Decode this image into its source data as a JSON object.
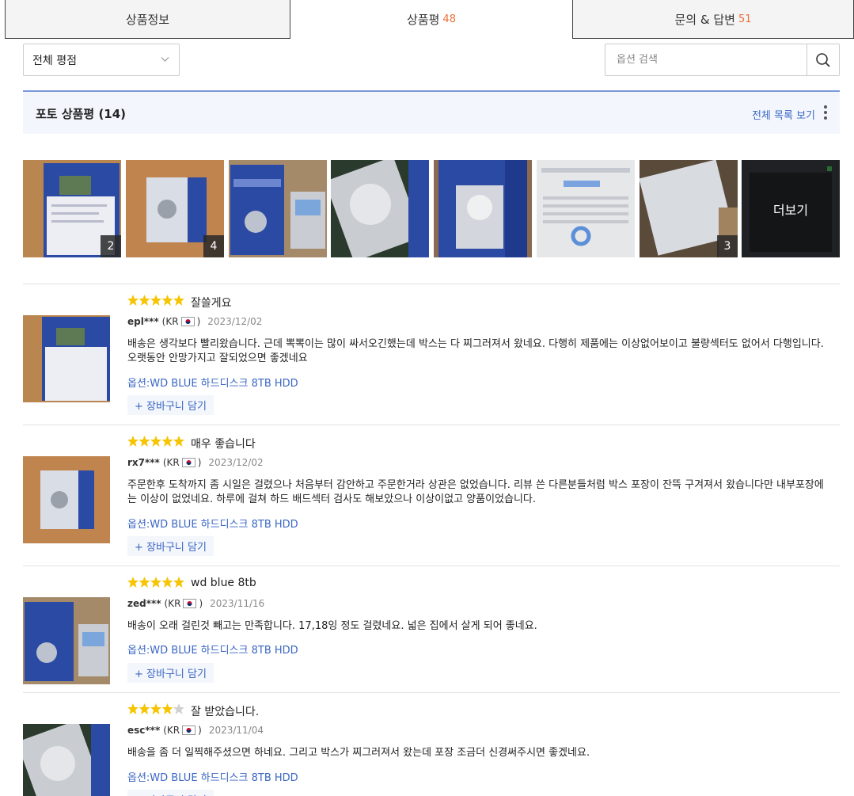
{
  "tabs": [
    {
      "label": "상품정보",
      "count": ""
    },
    {
      "label": "상품평",
      "count": "48"
    },
    {
      "label": "문의 & 답변",
      "count": "51"
    }
  ],
  "filter": {
    "selected": "전체 평점"
  },
  "search": {
    "placeholder": "옵션 검색"
  },
  "photo_reviews": {
    "title": "포토 상품평 (14)",
    "view_all": "전체 목록 보기",
    "thumbnails": [
      {
        "badge": "2"
      },
      {
        "badge": "4"
      },
      {
        "badge": ""
      },
      {
        "badge": ""
      },
      {
        "badge": ""
      },
      {
        "badge": ""
      },
      {
        "badge": "3"
      },
      {
        "more_label": "더보기"
      }
    ]
  },
  "reviews": [
    {
      "rating": 5,
      "title": "잘쓸게요",
      "user": "epl***",
      "country": "(KR",
      "country_close": ")",
      "date": "2023/12/02",
      "body": "배송은 생각보다 빨리왔습니다. 근데 뽁뽁이는 많이 싸서오긴했는데 박스는 다 찌그러져서 왔네요. 다행히 제품에는 이상없어보이고 불량섹터도 없어서 다행입니다. 오랫동안 안망가지고 잘되었으면 좋겠네요",
      "option": "옵션:WD BLUE 하드디스크 8TB HDD",
      "cart": "+ 장바구니 담기"
    },
    {
      "rating": 5,
      "title": "매우 좋습니다",
      "user": "rx7***",
      "country": "(KR",
      "country_close": ")",
      "date": "2023/12/02",
      "body": "주문한후 도착까지 좀 시일은 걸렸으나 처음부터 감안하고 주문한거라 상관은 없었습니다. 리뷰 쓴 다른분들처럼 박스 포장이 잔뜩 구겨져서 왔습니다만 내부포장에는 이상이 없었네요. 하루에 걸쳐 하드 배드섹터 검사도 해보았으나 이상이없고 양품이었습니다.",
      "option": "옵션:WD BLUE 하드디스크 8TB HDD",
      "cart": "+ 장바구니 담기"
    },
    {
      "rating": 5,
      "title": "wd blue 8tb",
      "user": "zed***",
      "country": "(KR",
      "country_close": ")",
      "date": "2023/11/16",
      "body": "배송이 오래 걸린것 빼고는 만족합니다. 17,18잉 정도 걸렸네요. 넓은 집에서 살게 되어 좋네요.",
      "option": "옵션:WD BLUE 하드디스크 8TB HDD",
      "cart": "+ 장바구니 담기"
    },
    {
      "rating": 4,
      "title": "잘 받았습니다.",
      "user": "esc***",
      "country": "(KR",
      "country_close": ")",
      "date": "2023/11/04",
      "body": "배송을 좀 더 일찍해주셨으면 하네요. 그리고 박스가 찌그러져서 왔는데 포장 조금더 신경써주시면 좋겠네요.",
      "option": "옵션:WD BLUE 하드디스크 8TB HDD",
      "cart": "+ 장바구니 담기"
    }
  ],
  "colors": {
    "accent": "#3a66c4",
    "count": "#e8703a",
    "star": "#f6c400",
    "star_empty": "#d0d0d0"
  }
}
